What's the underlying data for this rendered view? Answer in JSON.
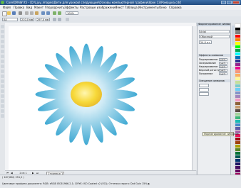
{
  "window": {
    "title": "CorelDRAW X5 - [D:\\Ljuy_images\\Дети для уроков\\ следующие\\Основы компьютерной графики\\Урок 13\\Ромашка.cdr]"
  },
  "menu": [
    "Файл",
    "Правка",
    "Вид",
    "Макет",
    "Упорядочить",
    "Эффекты",
    "Растровые изображения",
    "Текст",
    "Таблица",
    "Инструменты",
    "Окно",
    "Справка"
  ],
  "toolbar": {
    "zoom": "100%",
    "page_size": "A4",
    "width": "210,0 мм",
    "height": "297,0 мм"
  },
  "docker": {
    "title": "Форматирование символов",
    "font": "Arial",
    "style": "Обычный",
    "size": "24,0 пт",
    "section_effects": "Эффекты символов",
    "rows": [
      {
        "label": "Подчеркивание",
        "value": "(нет)"
      },
      {
        "label": "Зачеркивание",
        "value": "(нет)"
      },
      {
        "label": "Надчеркивание",
        "value": "(нет)"
      },
      {
        "label": "Верхний регистр",
        "value": "(нет)"
      },
      {
        "label": "Положение",
        "value": "(нет)"
      }
    ],
    "section_offset": "Смещение символов"
  },
  "pagebar": {
    "counter": "1 из 1",
    "page_tab": "Страница 1"
  },
  "tooltip": "Форматирование символов",
  "status": {
    "coords": "( 187,656; 251,2 )",
    "profiles": "Цветовые профили документа: RGB: sRGB IEC61966-2.1; CMYK: ISO Coated v2 (ECI); Оттенки серого: Dot Gain 15% ▶"
  },
  "colors": {
    "petal_center": "#ffffff",
    "petal_tip": "#3fa9d3",
    "flower_center": "#f7d93a",
    "accent": "#234d82"
  }
}
